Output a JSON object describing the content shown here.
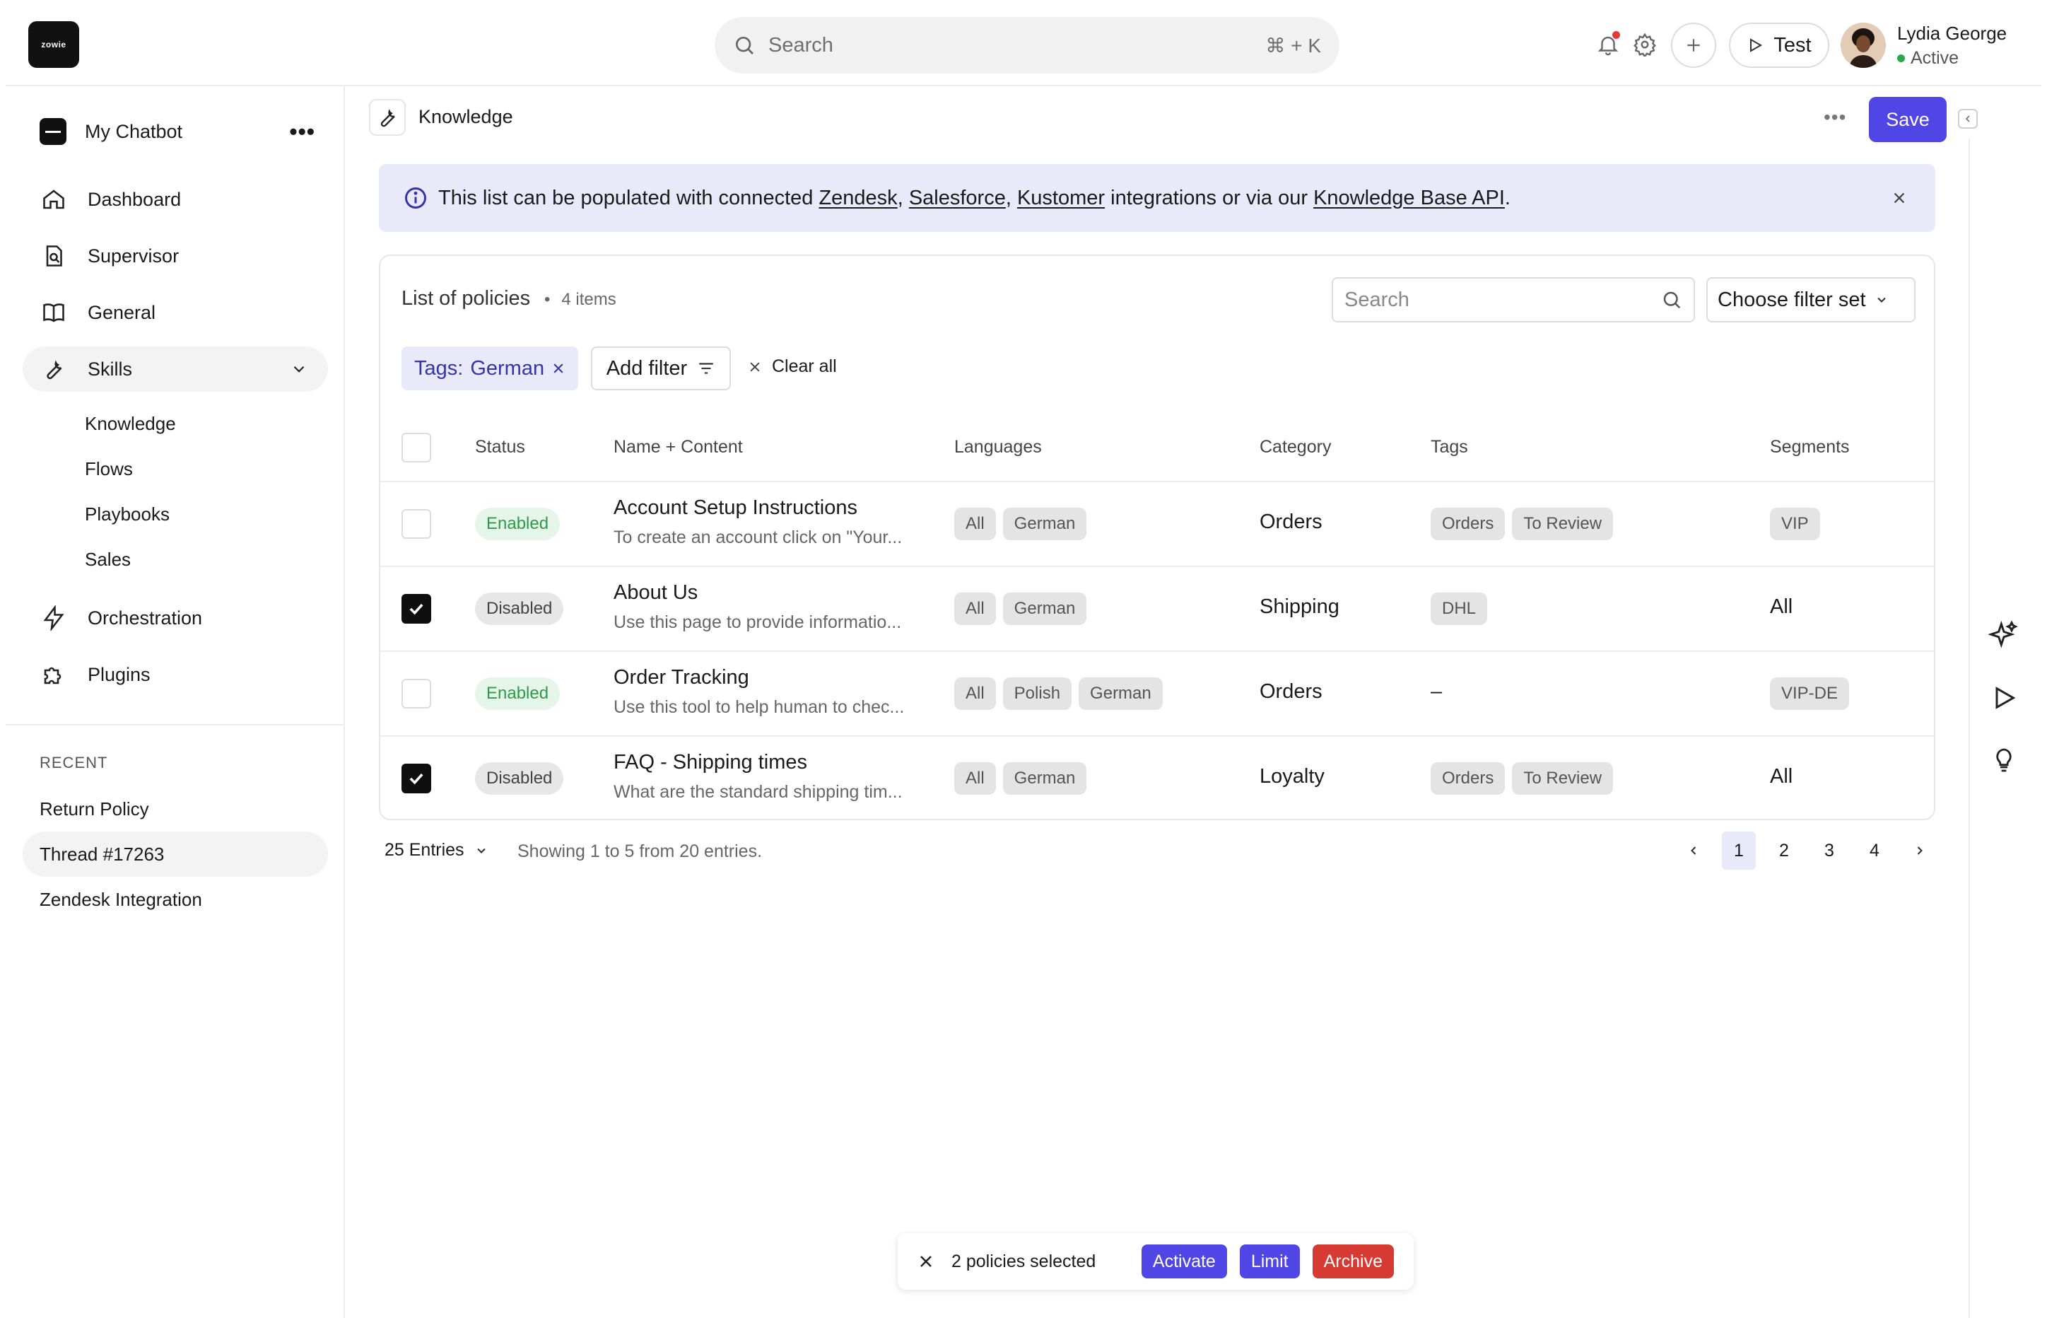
{
  "app": {
    "logo_text": "zowie"
  },
  "topbar": {
    "search_placeholder": "Search",
    "search_shortcut": "⌘ + K",
    "test_label": "Test",
    "user": {
      "name": "Lydia George",
      "status": "Active",
      "status_color": "#2ba84a"
    }
  },
  "sidebar": {
    "bot_name": "My Chatbot",
    "items": [
      {
        "label": "Dashboard",
        "icon": "home-icon"
      },
      {
        "label": "Supervisor",
        "icon": "supervisor-icon"
      },
      {
        "label": "General",
        "icon": "book-icon"
      },
      {
        "label": "Skills",
        "icon": "wrench-icon",
        "expanded": true
      },
      {
        "label": "Orchestration",
        "icon": "lightning-icon"
      },
      {
        "label": "Plugins",
        "icon": "puzzle-icon"
      }
    ],
    "subitems": [
      "Knowledge",
      "Flows",
      "Playbooks",
      "Sales"
    ],
    "recent_header": "RECENT",
    "recent": [
      "Return Policy",
      "Thread #17263",
      "Zendesk Integration"
    ]
  },
  "page": {
    "title": "Knowledge",
    "save_label": "Save"
  },
  "banner": {
    "prefix": "This list can be populated with connected",
    "link1": "Zendesk",
    "sep1": ",",
    "link2": "Salesforce",
    "sep2": ",",
    "link3": "Kustomer",
    "middle": "integrations or via our",
    "link4": "Knowledge Base API",
    "suffix": "."
  },
  "list": {
    "title": "List of policies",
    "count": "4 items",
    "search_placeholder": "Search",
    "filter_set": "Choose filter set",
    "active_filter_key": "Tags:",
    "active_filter_value": "German",
    "add_filter": "Add filter",
    "clear_all": "Clear all",
    "columns": [
      "Status",
      "Name + Content",
      "Languages",
      "Category",
      "Tags",
      "Segments"
    ],
    "rows": [
      {
        "checked": false,
        "status": "Enabled",
        "name": "Account Setup Instructions",
        "desc": "To create an account click on \"Your...",
        "languages": [
          "All",
          "German"
        ],
        "category": "Orders",
        "tags": [
          "Orders",
          "To Review"
        ],
        "segment": "VIP",
        "segment_pill": true
      },
      {
        "checked": true,
        "status": "Disabled",
        "name": "About Us",
        "desc": "Use this page to provide informatio...",
        "languages": [
          "All",
          "German"
        ],
        "category": "Shipping",
        "tags": [
          "DHL"
        ],
        "segment": "All",
        "segment_pill": false
      },
      {
        "checked": false,
        "status": "Enabled",
        "name": "Order Tracking",
        "desc": "Use this tool to help human to chec...",
        "languages": [
          "All",
          "Polish",
          "German"
        ],
        "category": "Orders",
        "tags": [],
        "tags_empty": "–",
        "segment": "VIP-DE",
        "segment_pill": true
      },
      {
        "checked": true,
        "status": "Disabled",
        "name": "FAQ - Shipping times",
        "desc": "What are the standard shipping tim...",
        "languages": [
          "All",
          "German"
        ],
        "category": "Loyalty",
        "tags": [
          "Orders",
          "To Review"
        ],
        "segment": "All",
        "segment_pill": false
      }
    ]
  },
  "footer": {
    "entries": "25 Entries",
    "showing": "Showing 1 to 5 from 20 entries.",
    "pages": [
      "1",
      "2",
      "3",
      "4"
    ],
    "current_page": "1"
  },
  "selection_bar": {
    "text": "2 policies selected",
    "activate": "Activate",
    "limit": "Limit",
    "archive": "Archive"
  },
  "colors": {
    "accent": "#4f46e5",
    "danger": "#d63a33",
    "banner_bg": "#e9e9f9"
  }
}
